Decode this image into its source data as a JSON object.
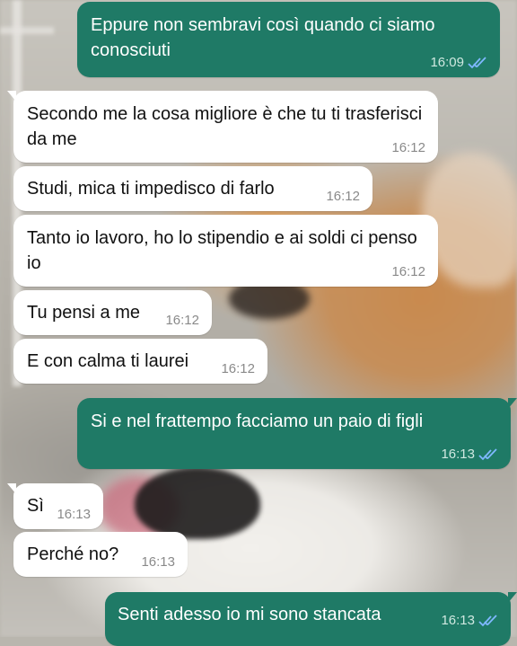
{
  "colors": {
    "incoming_bubble": "#ffffff",
    "outgoing_bubble": "#1f7a66",
    "read_ticks": "#7fb8ff"
  },
  "messages": [
    {
      "direction": "out",
      "text": "Eppure non sembravi così quando ci siamo conosciuti",
      "time": "16:09",
      "status": "read"
    },
    {
      "direction": "in",
      "text": "Secondo me la cosa migliore è che tu ti trasferisci da me",
      "time": "16:12"
    },
    {
      "direction": "in",
      "text": "Studi, mica ti impedisco di farlo",
      "time": "16:12"
    },
    {
      "direction": "in",
      "text": "Tanto io lavoro, ho lo stipendio e ai soldi ci penso io",
      "time": "16:12"
    },
    {
      "direction": "in",
      "text": "Tu pensi a me",
      "time": "16:12"
    },
    {
      "direction": "in",
      "text": "E con calma ti laurei",
      "time": "16:12"
    },
    {
      "direction": "out",
      "text": "Si e nel frattempo facciamo un paio di figli",
      "time": "16:13",
      "status": "read"
    },
    {
      "direction": "in",
      "text": "Sì",
      "time": "16:13"
    },
    {
      "direction": "in",
      "text": "Perché no?",
      "time": "16:13"
    },
    {
      "direction": "out",
      "text": "Senti adesso io mi sono stancata",
      "time": "16:13",
      "status": "read"
    }
  ],
  "icons": {
    "read_receipt": "double-check-icon"
  }
}
